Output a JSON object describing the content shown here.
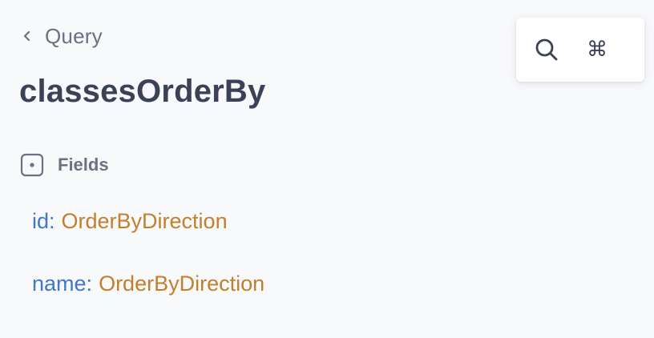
{
  "breadcrumb": {
    "label": "Query",
    "icon": "chevron-left-icon"
  },
  "page": {
    "title": "classesOrderBy"
  },
  "fields_section": {
    "label": "Fields",
    "icon": "field-box-icon",
    "fields": [
      {
        "name": "id",
        "colon": ":",
        "type": "OrderByDirection"
      },
      {
        "name": "name",
        "colon": ":",
        "type": "OrderByDirection"
      }
    ]
  },
  "search": {
    "icon": "search-icon",
    "shortcut_key": "⌘"
  },
  "colors": {
    "background": "#f8f9fb",
    "title": "#3b4257",
    "muted": "#6b7183",
    "field_name": "#3f78c8",
    "field_type": "#c27f2c"
  }
}
